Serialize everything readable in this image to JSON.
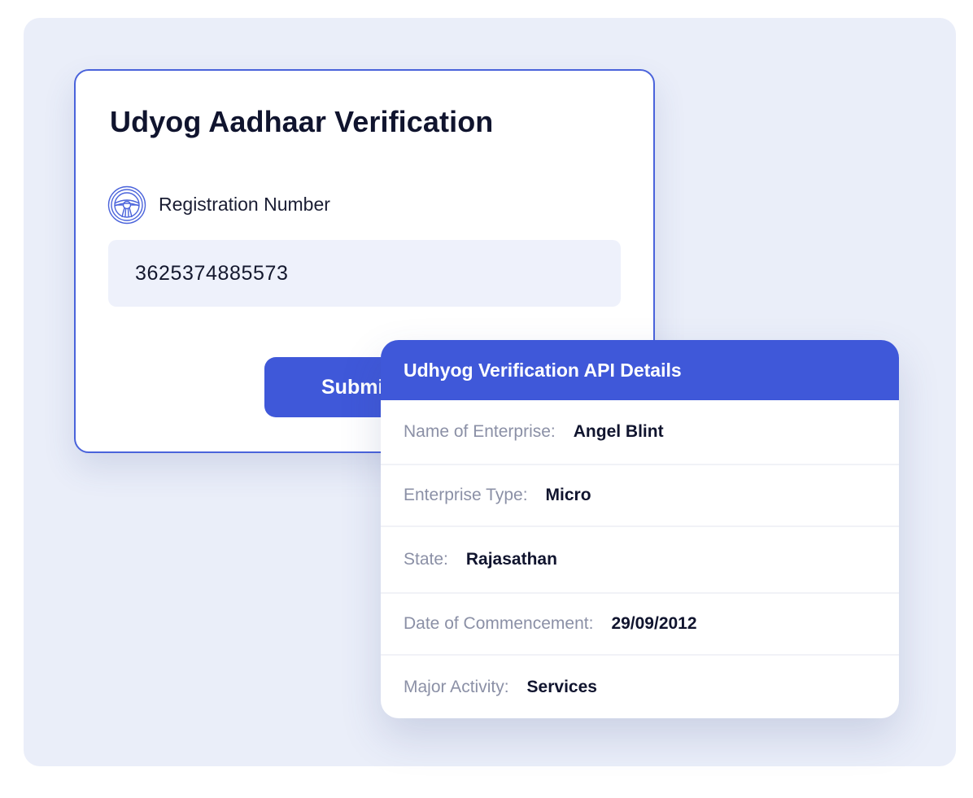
{
  "form": {
    "title": "Udyog Aadhaar Verification",
    "field_label": "Registration Number",
    "field_icon": "steering-wheel-icon",
    "registration_number": "3625374885573",
    "submit_label": "Submit"
  },
  "details": {
    "header": "Udhyog Verification API Details",
    "rows": [
      {
        "label": "Name of Enterprise:",
        "value": "Angel Blint"
      },
      {
        "label": "Enterprise Type:",
        "value": "Micro"
      },
      {
        "label": "State:",
        "value": "Rajasathan"
      },
      {
        "label": "Date of Commencement:",
        "value": "29/09/2012"
      },
      {
        "label": "Major Activity:",
        "value": "Services"
      }
    ]
  },
  "colors": {
    "accent": "#3f58d9",
    "card_border": "#4a63db",
    "background_panel": "#eaeef9",
    "input_background": "#eef1fb",
    "label_gray": "#8b90a6",
    "text_dark": "#10142e"
  }
}
